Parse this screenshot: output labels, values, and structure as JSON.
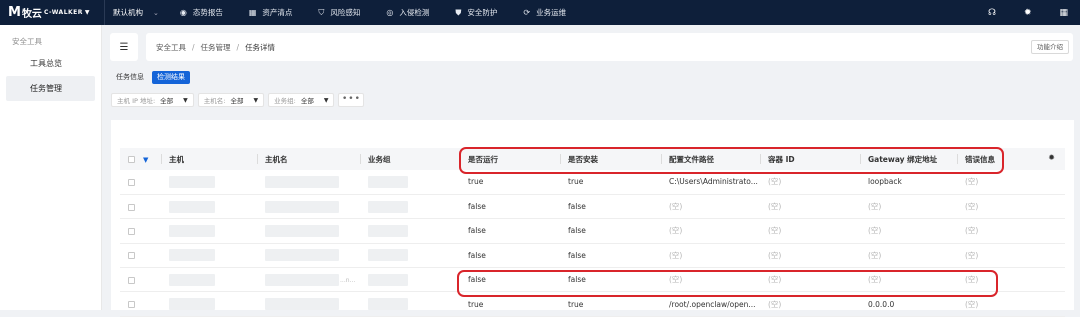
{
  "topbar": {
    "logo_mark": "M",
    "logo_cn": "牧云",
    "logo_en": "C-WALKER",
    "org_label": "默认机构",
    "nav": [
      {
        "label": "态势报告",
        "icon": "dashboard-icon"
      },
      {
        "label": "资产清点",
        "icon": "asset-icon"
      },
      {
        "label": "风险感知",
        "icon": "shield-icon"
      },
      {
        "label": "入侵检测",
        "icon": "globe-icon"
      },
      {
        "label": "安全防护",
        "icon": "shield-check-icon"
      },
      {
        "label": "业务运维",
        "icon": "sync-icon"
      }
    ]
  },
  "sidebar": {
    "group": "安全工具",
    "items": [
      {
        "label": "工具总览",
        "active": false
      },
      {
        "label": "任务管理",
        "active": true
      }
    ]
  },
  "breadcrumb": {
    "items": [
      "安全工具",
      "任务管理",
      "任务详情"
    ],
    "func_button": "功能介绍"
  },
  "tabs": [
    {
      "label": "任务信息",
      "active": false
    },
    {
      "label": "检测结果",
      "active": true
    }
  ],
  "filters": [
    {
      "label": "主机 IP 地址:",
      "value": "全部"
    },
    {
      "label": "主机名:",
      "value": "全部"
    },
    {
      "label": "业务组:",
      "value": "全部"
    }
  ],
  "more_button": "•••",
  "table": {
    "columns": [
      "主机",
      "主机名",
      "业务组",
      "是否运行",
      "是否安装",
      "配置文件路径",
      "容器 ID",
      "Gateway 绑定地址",
      "错误信息"
    ],
    "rows": [
      {
        "running": "true",
        "installed": "true",
        "config_path": "C:\\Users\\Administrato...",
        "container_id": "(空)",
        "gateway": "loopback",
        "error": "(空)",
        "hostname_suffix": ""
      },
      {
        "running": "false",
        "installed": "false",
        "config_path": "(空)",
        "container_id": "(空)",
        "gateway": "(空)",
        "error": "(空)",
        "hostname_suffix": ""
      },
      {
        "running": "false",
        "installed": "false",
        "config_path": "(空)",
        "container_id": "(空)",
        "gateway": "(空)",
        "error": "(空)",
        "hostname_suffix": ""
      },
      {
        "running": "false",
        "installed": "false",
        "config_path": "(空)",
        "container_id": "(空)",
        "gateway": "(空)",
        "error": "(空)",
        "hostname_suffix": ""
      },
      {
        "running": "false",
        "installed": "false",
        "config_path": "(空)",
        "container_id": "(空)",
        "gateway": "(空)",
        "error": "(空)",
        "hostname_suffix": "...n..."
      },
      {
        "running": "true",
        "installed": "true",
        "config_path": "/root/.openclaw/open...",
        "container_id": "(空)",
        "gateway": "0.0.0.0",
        "error": "(空)",
        "hostname_suffix": ""
      }
    ]
  },
  "colors": {
    "topbar_bg": "#0e1f3a",
    "accent": "#1464d8",
    "highlight": "#d9252b",
    "empty_text": "#b4b4b4"
  }
}
